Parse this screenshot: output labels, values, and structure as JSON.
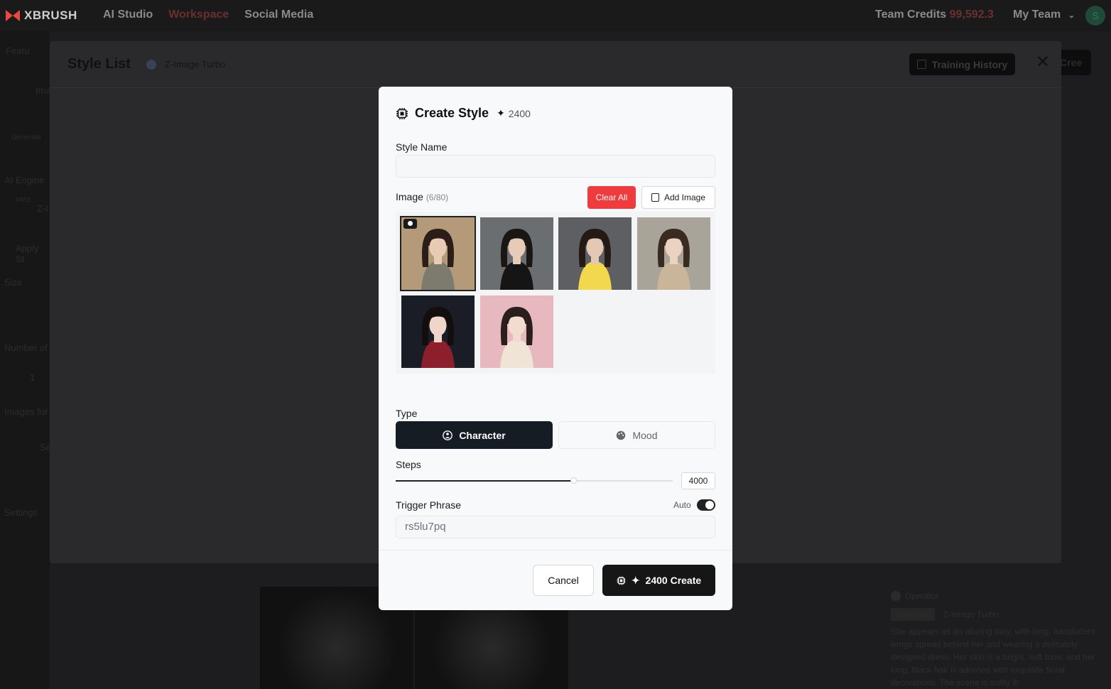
{
  "app": {
    "brand": "XBRUSH",
    "nav": [
      "AI Studio",
      "Workspace",
      "Social Media"
    ],
    "credits_label": "Team Credits",
    "credits_value": "99,592.3",
    "team_label": "My Team",
    "avatar_initial": "S"
  },
  "background": {
    "side_labels": [
      "Featu",
      "Ima",
      "Generate",
      "AI Engine",
      "FREE",
      "Z-I",
      "Apply St",
      "Size",
      "Number of",
      "1",
      "Images for",
      "Se",
      "Settings"
    ],
    "create_button": "Cree",
    "operator_label": "Operator",
    "operator_tags": [
      "Generate",
      "Z-Image Turbo"
    ],
    "operator_text": "She appears as an alluring fairy, with long, translucent wings spread behind her and wearing a delicately designed dress. Her skin is a bright, soft tone, and her long, black hair is adorned with exquisite floral decorations. The scene is softly lit"
  },
  "style_list": {
    "title": "Style List",
    "engine": "Z-Image Turbo",
    "history_button": "Training History",
    "close": "✕"
  },
  "dialog": {
    "title": "Create Style",
    "cost": "2400",
    "style_name_label": "Style Name",
    "style_name_value": "",
    "image_label": "Image",
    "image_count": "(6/80)",
    "clear_all": "Clear All",
    "add_image": "Add Image",
    "images": [
      {
        "name": "image-1",
        "bg": "#b59a7a",
        "skin": "#e8cbb5",
        "hair": "#2b1d17",
        "cloth": "#7d7a6e"
      },
      {
        "name": "image-2",
        "bg": "#6b6e70",
        "skin": "#e6cbb9",
        "hair": "#1a1614",
        "cloth": "#151515"
      },
      {
        "name": "image-3",
        "bg": "#5e5f63",
        "skin": "#e3c8b3",
        "hair": "#241a16",
        "cloth": "#f1d84c"
      },
      {
        "name": "image-4",
        "bg": "#a8a49a",
        "skin": "#ecd2c0",
        "hair": "#3a2a20",
        "cloth": "#c9b59a"
      },
      {
        "name": "image-5",
        "bg": "#1a1d25",
        "skin": "#efd6c8",
        "hair": "#120e0e",
        "cloth": "#8d1f2c"
      },
      {
        "name": "image-6",
        "bg": "#e7b9bf",
        "skin": "#f2dccf",
        "hair": "#2a1f1c",
        "cloth": "#efe4d6"
      }
    ],
    "type_label": "Type",
    "type_options": [
      "Character",
      "Mood"
    ],
    "type_selected": "Character",
    "steps_label": "Steps",
    "steps_value": "4000",
    "steps_fraction": 0.64,
    "trigger_label": "Trigger Phrase",
    "auto_label": "Auto",
    "auto_on": true,
    "trigger_value": "rs5lu7pq",
    "cancel": "Cancel",
    "create": "2400 Create"
  }
}
